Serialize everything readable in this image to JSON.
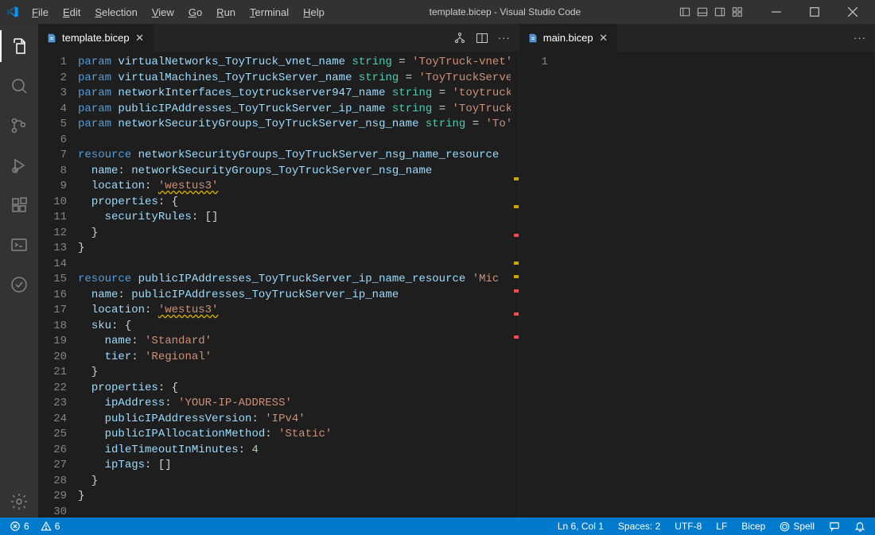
{
  "menu": [
    "File",
    "Edit",
    "Selection",
    "View",
    "Go",
    "Run",
    "Terminal",
    "Help"
  ],
  "title": "template.bicep - Visual Studio Code",
  "tabs": {
    "left": "template.bicep",
    "right": "main.bicep"
  },
  "rightEditor": {
    "lines": [
      "1"
    ]
  },
  "code": [
    {
      "n": 1,
      "t": [
        [
          "kw",
          "param "
        ],
        [
          "id",
          "virtualNetworks_ToyTruck_vnet_name "
        ],
        [
          "ty",
          "string "
        ],
        [
          "op",
          "= "
        ],
        [
          "st",
          "'ToyTruck-vnet'"
        ]
      ]
    },
    {
      "n": 2,
      "t": [
        [
          "kw",
          "param "
        ],
        [
          "id",
          "virtualMachines_ToyTruckServer_name "
        ],
        [
          "ty",
          "string "
        ],
        [
          "op",
          "= "
        ],
        [
          "st",
          "'ToyTruckServer'"
        ]
      ]
    },
    {
      "n": 3,
      "t": [
        [
          "kw",
          "param "
        ],
        [
          "id",
          "networkInterfaces_toytruckserver947_name "
        ],
        [
          "ty",
          "string "
        ],
        [
          "op",
          "= "
        ],
        [
          "st",
          "'toytruck'"
        ]
      ]
    },
    {
      "n": 4,
      "t": [
        [
          "kw",
          "param "
        ],
        [
          "id",
          "publicIPAddresses_ToyTruckServer_ip_name "
        ],
        [
          "ty",
          "string "
        ],
        [
          "op",
          "= "
        ],
        [
          "st",
          "'ToyTruck'"
        ]
      ]
    },
    {
      "n": 5,
      "t": [
        [
          "kw",
          "param "
        ],
        [
          "id",
          "networkSecurityGroups_ToyTruckServer_nsg_name "
        ],
        [
          "ty",
          "string "
        ],
        [
          "op",
          "= "
        ],
        [
          "st",
          "'To'"
        ]
      ]
    },
    {
      "n": 6,
      "t": []
    },
    {
      "n": 7,
      "t": [
        [
          "kw",
          "resource "
        ],
        [
          "id",
          "networkSecurityGroups_ToyTruckServer_nsg_name_resource"
        ],
        [
          "op",
          " "
        ]
      ]
    },
    {
      "n": 8,
      "t": [
        [
          "op",
          "  "
        ],
        [
          "id",
          "name"
        ],
        [
          "op",
          ": "
        ],
        [
          "id",
          "networkSecurityGroups_ToyTruckServer_nsg_name"
        ]
      ]
    },
    {
      "n": 9,
      "t": [
        [
          "op",
          "  "
        ],
        [
          "id",
          "location"
        ],
        [
          "op",
          ": "
        ],
        [
          "st warn",
          "'westus3'"
        ]
      ]
    },
    {
      "n": 10,
      "t": [
        [
          "op",
          "  "
        ],
        [
          "id",
          "properties"
        ],
        [
          "op",
          ": {"
        ]
      ]
    },
    {
      "n": 11,
      "t": [
        [
          "op",
          "    "
        ],
        [
          "id",
          "securityRules"
        ],
        [
          "op",
          ": []"
        ]
      ]
    },
    {
      "n": 12,
      "t": [
        [
          "op",
          "  }"
        ]
      ]
    },
    {
      "n": 13,
      "t": [
        [
          "op",
          "}"
        ]
      ]
    },
    {
      "n": 14,
      "t": []
    },
    {
      "n": 15,
      "t": [
        [
          "kw",
          "resource "
        ],
        [
          "id",
          "publicIPAddresses_ToyTruckServer_ip_name_resource "
        ],
        [
          "st",
          "'Mic"
        ]
      ]
    },
    {
      "n": 16,
      "t": [
        [
          "op",
          "  "
        ],
        [
          "id",
          "name"
        ],
        [
          "op",
          ": "
        ],
        [
          "id",
          "publicIPAddresses_ToyTruckServer_ip_name"
        ]
      ]
    },
    {
      "n": 17,
      "t": [
        [
          "op",
          "  "
        ],
        [
          "id",
          "location"
        ],
        [
          "op",
          ": "
        ],
        [
          "st warn",
          "'westus3'"
        ]
      ]
    },
    {
      "n": 18,
      "t": [
        [
          "op",
          "  "
        ],
        [
          "id",
          "sku"
        ],
        [
          "op",
          ": {"
        ]
      ]
    },
    {
      "n": 19,
      "t": [
        [
          "op",
          "    "
        ],
        [
          "id",
          "name"
        ],
        [
          "op",
          ": "
        ],
        [
          "st",
          "'Standard'"
        ]
      ]
    },
    {
      "n": 20,
      "t": [
        [
          "op",
          "    "
        ],
        [
          "id",
          "tier"
        ],
        [
          "op",
          ": "
        ],
        [
          "st",
          "'Regional'"
        ]
      ]
    },
    {
      "n": 21,
      "t": [
        [
          "op",
          "  }"
        ]
      ]
    },
    {
      "n": 22,
      "t": [
        [
          "op",
          "  "
        ],
        [
          "id",
          "properties"
        ],
        [
          "op",
          ": {"
        ]
      ]
    },
    {
      "n": 23,
      "t": [
        [
          "op",
          "    "
        ],
        [
          "id",
          "ipAddress"
        ],
        [
          "op",
          ": "
        ],
        [
          "st",
          "'YOUR-IP-ADDRESS'"
        ]
      ]
    },
    {
      "n": 24,
      "t": [
        [
          "op",
          "    "
        ],
        [
          "id",
          "publicIPAddressVersion"
        ],
        [
          "op",
          ": "
        ],
        [
          "st",
          "'IPv4'"
        ]
      ]
    },
    {
      "n": 25,
      "t": [
        [
          "op",
          "    "
        ],
        [
          "id",
          "publicIPAllocationMethod"
        ],
        [
          "op",
          ": "
        ],
        [
          "st",
          "'Static'"
        ]
      ]
    },
    {
      "n": 26,
      "t": [
        [
          "op",
          "    "
        ],
        [
          "id",
          "idleTimeoutInMinutes"
        ],
        [
          "op",
          ": "
        ],
        [
          "nu",
          "4"
        ]
      ]
    },
    {
      "n": 27,
      "t": [
        [
          "op",
          "    "
        ],
        [
          "id",
          "ipTags"
        ],
        [
          "op",
          ": []"
        ]
      ]
    },
    {
      "n": 28,
      "t": [
        [
          "op",
          "  }"
        ]
      ]
    },
    {
      "n": 29,
      "t": [
        [
          "op",
          "}"
        ]
      ]
    },
    {
      "n": 30,
      "t": []
    }
  ],
  "markers": [
    {
      "c": "y",
      "p": 27
    },
    {
      "c": "y",
      "p": 33
    },
    {
      "c": "r",
      "p": 39
    },
    {
      "c": "y",
      "p": 45
    },
    {
      "c": "y",
      "p": 48
    },
    {
      "c": "r",
      "p": 51
    },
    {
      "c": "r",
      "p": 56
    },
    {
      "c": "r",
      "p": 61
    }
  ],
  "status": {
    "errors": "6",
    "warnings": "6",
    "pos": "Ln 6, Col 1",
    "spaces": "Spaces: 2",
    "enc": "UTF-8",
    "eol": "LF",
    "lang": "Bicep",
    "spell": "Spell"
  }
}
